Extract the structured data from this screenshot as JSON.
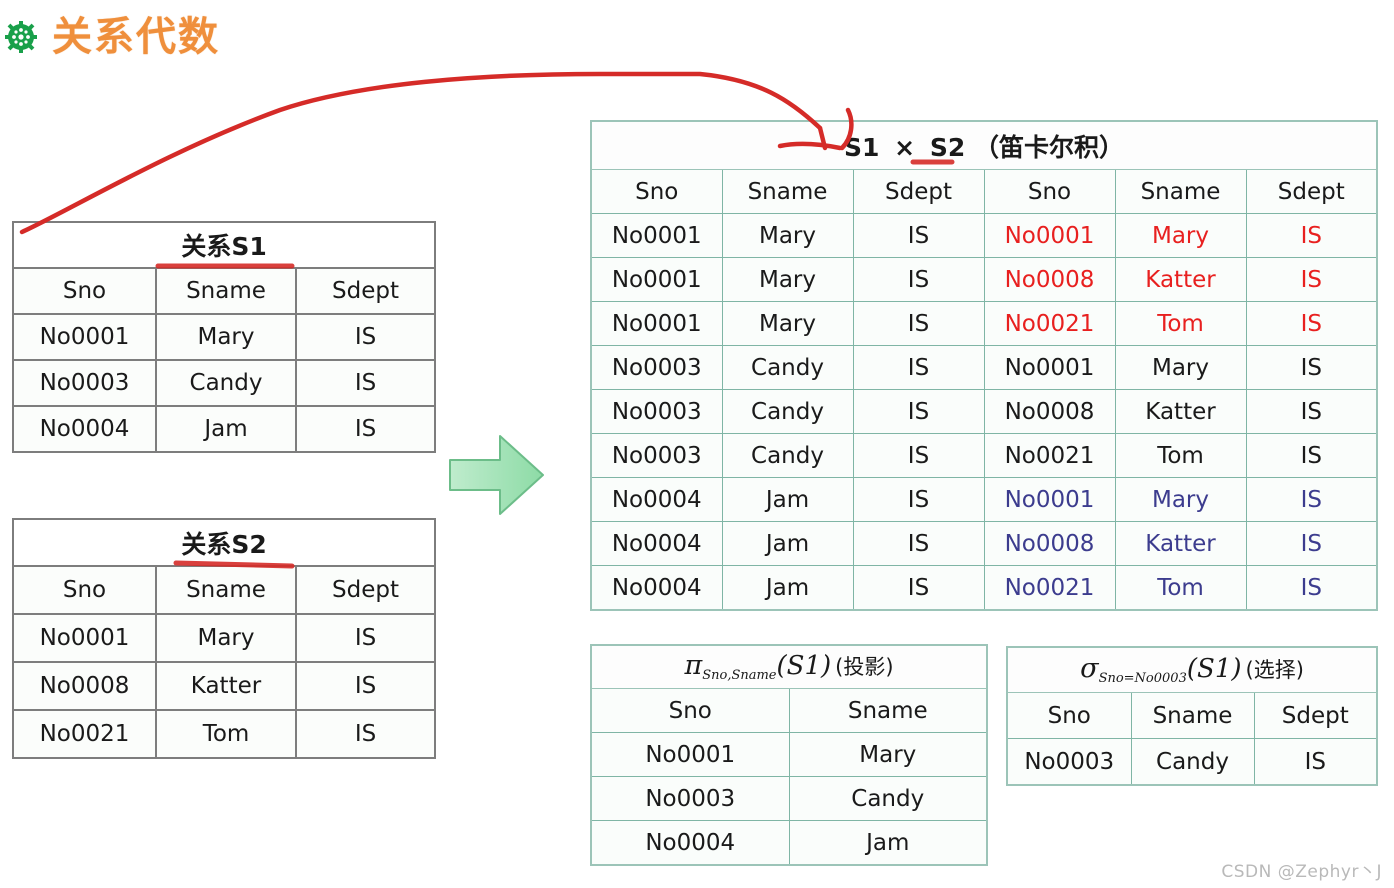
{
  "slide": {
    "title": "关系代数",
    "bullet_icon": "green-flower-bullet-icon",
    "title_color": "#ef8f3c",
    "background": "#ffffff"
  },
  "watermark": {
    "text": "CSDN @Zephyr丶J"
  },
  "annotations": {
    "green_arrow_icon": "green-right-arrow",
    "red_curve_icon": "red-handdrawn-arrow",
    "red_underline_s1_icon": "red-underline",
    "red_underline_s2_icon": "red-underline",
    "red_underline_product_icon": "red-underline",
    "red_color": "#d52b28",
    "green_arrow_color": "#9fe0b4"
  },
  "table_s1": {
    "caption": "关系S1",
    "columns": [
      "Sno",
      "Sname",
      "Sdept"
    ],
    "rows": [
      [
        "No0001",
        "Mary",
        "IS"
      ],
      [
        "No0003",
        "Candy",
        "IS"
      ],
      [
        "No0004",
        "Jam",
        "IS"
      ]
    ]
  },
  "table_s2": {
    "caption": "关系S2",
    "columns": [
      "Sno",
      "Sname",
      "Sdept"
    ],
    "rows": [
      [
        "No0001",
        "Mary",
        "IS"
      ],
      [
        "No0008",
        "Katter",
        "IS"
      ],
      [
        "No0021",
        "Tom",
        "IS"
      ]
    ]
  },
  "table_product": {
    "caption": {
      "left": "S1",
      "operator": "×",
      "right": "S2",
      "note": "（笛卡尔积）"
    },
    "columns": [
      "Sno",
      "Sname",
      "Sdept",
      "Sno",
      "Sname",
      "Sdept"
    ],
    "rows": [
      {
        "highlight": "red",
        "cells": [
          "No0001",
          "Mary",
          "IS",
          "No0001",
          "Mary",
          "IS"
        ]
      },
      {
        "highlight": "red",
        "cells": [
          "No0001",
          "Mary",
          "IS",
          "No0008",
          "Katter",
          "IS"
        ]
      },
      {
        "highlight": "red",
        "cells": [
          "No0001",
          "Mary",
          "IS",
          "No0021",
          "Tom",
          "IS"
        ]
      },
      {
        "highlight": "none",
        "cells": [
          "No0003",
          "Candy",
          "IS",
          "No0001",
          "Mary",
          "IS"
        ]
      },
      {
        "highlight": "none",
        "cells": [
          "No0003",
          "Candy",
          "IS",
          "No0008",
          "Katter",
          "IS"
        ]
      },
      {
        "highlight": "none",
        "cells": [
          "No0003",
          "Candy",
          "IS",
          "No0021",
          "Tom",
          "IS"
        ]
      },
      {
        "highlight": "blue",
        "cells": [
          "No0004",
          "Jam",
          "IS",
          "No0001",
          "Mary",
          "IS"
        ]
      },
      {
        "highlight": "blue",
        "cells": [
          "No0004",
          "Jam",
          "IS",
          "No0008",
          "Katter",
          "IS"
        ]
      },
      {
        "highlight": "blue",
        "cells": [
          "No0004",
          "Jam",
          "IS",
          "No0021",
          "Tom",
          "IS"
        ]
      }
    ],
    "highlight_colors": {
      "red": "#e8201f",
      "blue": "#3c3c8e"
    }
  },
  "table_projection": {
    "caption": {
      "operator": "π",
      "subscript": "Sno,Sname",
      "argument": "(S1)",
      "note": "(投影)"
    },
    "columns": [
      "Sno",
      "Sname"
    ],
    "rows": [
      [
        "No0001",
        "Mary"
      ],
      [
        "No0003",
        "Candy"
      ],
      [
        "No0004",
        "Jam"
      ]
    ]
  },
  "table_selection": {
    "caption": {
      "operator": "σ",
      "subscript": "Sno=No0003",
      "argument": "(S1)",
      "note": "(选择)"
    },
    "columns": [
      "Sno",
      "Sname",
      "Sdept"
    ],
    "rows": [
      [
        "No0003",
        "Candy",
        "IS"
      ]
    ]
  }
}
